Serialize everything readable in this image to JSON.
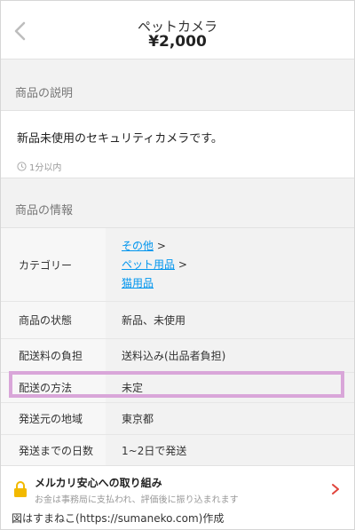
{
  "header": {
    "title": "ペットカメラ",
    "price": "¥2,000"
  },
  "description": {
    "section_title": "商品の説明",
    "text": "新品未使用のセキュリティカメラです。",
    "time": "1分以内"
  },
  "info": {
    "section_title": "商品の情報",
    "category_label": "カテゴリー",
    "categories": [
      "その他",
      "ペット用品",
      "猫用品"
    ],
    "category_sep": ">",
    "rows": [
      {
        "label": "商品の状態",
        "value": "新品、未使用"
      },
      {
        "label": "配送料の負担",
        "value": "送料込み(出品者負担)"
      },
      {
        "label": "配送の方法",
        "value": "未定"
      },
      {
        "label": "発送元の地域",
        "value": "東京都"
      },
      {
        "label": "発送までの日数",
        "value": "1~2日で発送"
      }
    ]
  },
  "anshin": {
    "title": "メルカリ安心への取り組み",
    "subtitle": "お金は事務局に支払われ、評価後に振り込まれます"
  },
  "credit": "図はすまねこ(https://sumaneko.com)作成",
  "colors": {
    "link": "#0095ee",
    "highlight": "#d9a6d9",
    "accent_red": "#e0443c",
    "lock": "#f2b900"
  }
}
